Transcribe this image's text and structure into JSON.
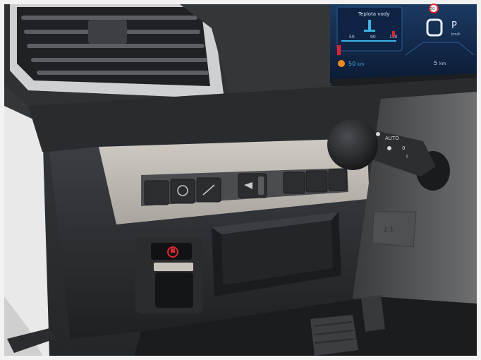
{
  "cluster": {
    "gauge_title": "Teplota vody",
    "gauge_ticks": [
      "50",
      "90",
      "130"
    ],
    "gear": "P",
    "speed_unit": "km/h",
    "speed_limit": "50",
    "range_left": "50",
    "range_left_unit": "km",
    "range_right": "5",
    "range_right_unit": "km"
  },
  "stalk": {
    "ring_labels": [
      "AUTO",
      "0",
      "I"
    ]
  },
  "panel": {
    "label": "2.1"
  },
  "colors": {
    "dash_dark": "#2b2e31",
    "panel_silver": "#b9b5ae",
    "screen_blue": "#12284a",
    "accent_red": "#e0262e",
    "accent_cyan": "#3ab4e6",
    "accent_orange": "#f08a1c"
  }
}
